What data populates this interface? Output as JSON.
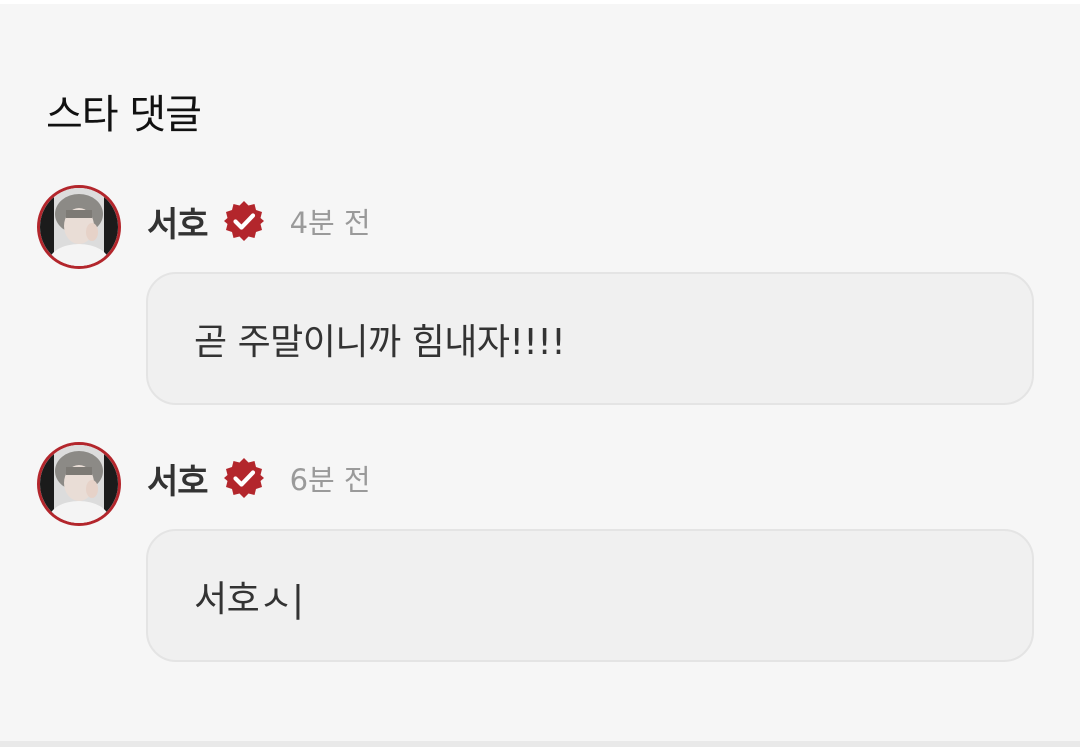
{
  "section": {
    "title": "스타 댓글"
  },
  "comments": [
    {
      "author": "서호",
      "time": "4분 전",
      "text": "곧 주말이니까 힘내자!!!!",
      "verified_icon": "verified-badge-icon"
    },
    {
      "author": "서호",
      "time": "6분 전",
      "text": "서호ㅅ|",
      "verified_icon": "verified-badge-icon"
    }
  ],
  "colors": {
    "accent": "#b3262c",
    "background": "#f6f6f6",
    "bubble": "#f0f0f0",
    "muted_text": "#9a9a9a"
  }
}
